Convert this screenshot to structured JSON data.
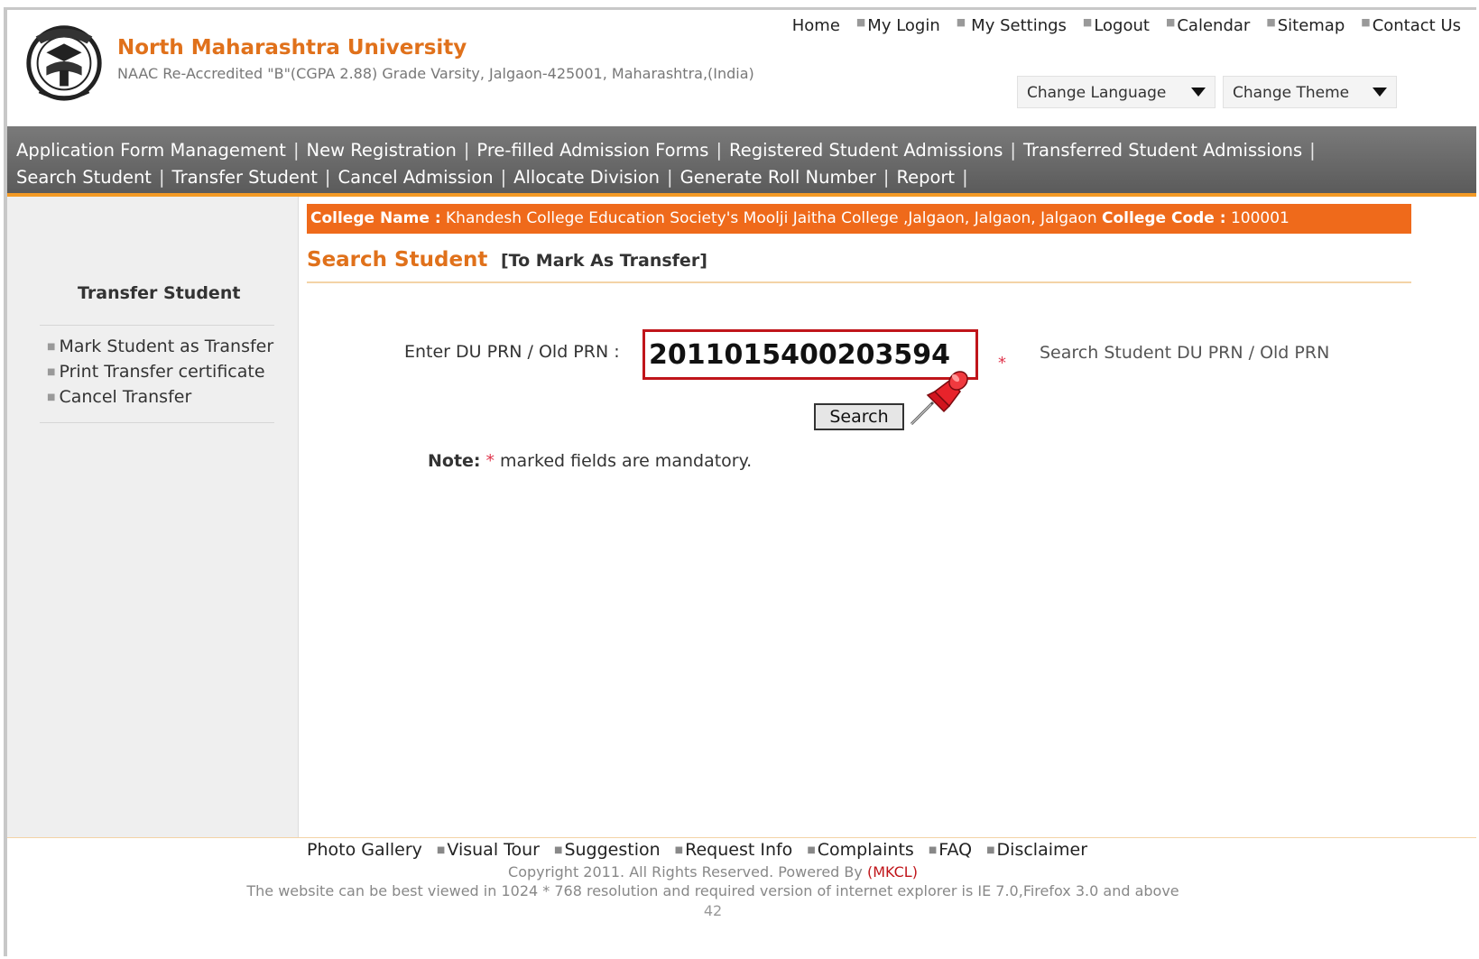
{
  "header": {
    "university_name": "North Maharashtra University",
    "subtitle": "NAAC Re-Accredited \"B\"(CGPA 2.88) Grade Varsity, Jalgaon-425001, Maharashtra,(India)",
    "top_links": [
      "Home",
      "My Login",
      "My Settings",
      "Logout",
      "Calendar",
      "Sitemap",
      "Contact Us"
    ],
    "change_language": "Change Language",
    "change_theme": "Change Theme"
  },
  "menu": {
    "row1": [
      "Application Form Management",
      "New Registration",
      "Pre-filled Admission Forms",
      "Registered Student Admissions",
      "Transferred Student Admissions"
    ],
    "row2": [
      "Search Student",
      "Transfer Student",
      "Cancel Admission",
      "Allocate Division",
      "Generate Roll Number",
      "Report"
    ],
    "separator": "|"
  },
  "sidebar": {
    "title": "Transfer Student",
    "items": [
      "Mark Student as Transfer",
      "Print Transfer certificate",
      "Cancel Transfer"
    ]
  },
  "college": {
    "name_label": "College Name :",
    "name_value": "Khandesh College Education Society's Moolji Jaitha College ,Jalgaon, Jalgaon, Jalgaon",
    "code_label": "College Code :",
    "code_value": "100001"
  },
  "form": {
    "title": "Search Student",
    "subtitle": "[To Mark As Transfer]",
    "prn_label": "Enter DU PRN / Old PRN :",
    "prn_value": "2011015400203594",
    "required_marker": "*",
    "hint": "Search Student DU PRN / Old PRN",
    "search_button": "Search",
    "note_label": "Note:",
    "note_star": "*",
    "note_text": "marked fields are mandatory."
  },
  "footer": {
    "links": [
      "Photo Gallery",
      "Visual Tour",
      "Suggestion",
      "Request Info",
      "Complaints",
      "FAQ",
      "Disclaimer"
    ],
    "copyright": "Copyright 2011. All Rights Reserved. Powered By",
    "powered_by": "(MKCL)",
    "resolution_note": "The website can be best viewed in 1024 * 768 resolution and required version of internet explorer is IE 7.0,Firefox 3.0 and above",
    "page_number": "42"
  },
  "colors": {
    "brand_orange": "#e0711b",
    "college_bar": "#ef6a1b",
    "menu_bar": "#666666",
    "highlight_red": "#c0151a"
  },
  "icons": [
    "university-seal-logo",
    "pushpin-icon",
    "dropdown-caret-icon"
  ]
}
